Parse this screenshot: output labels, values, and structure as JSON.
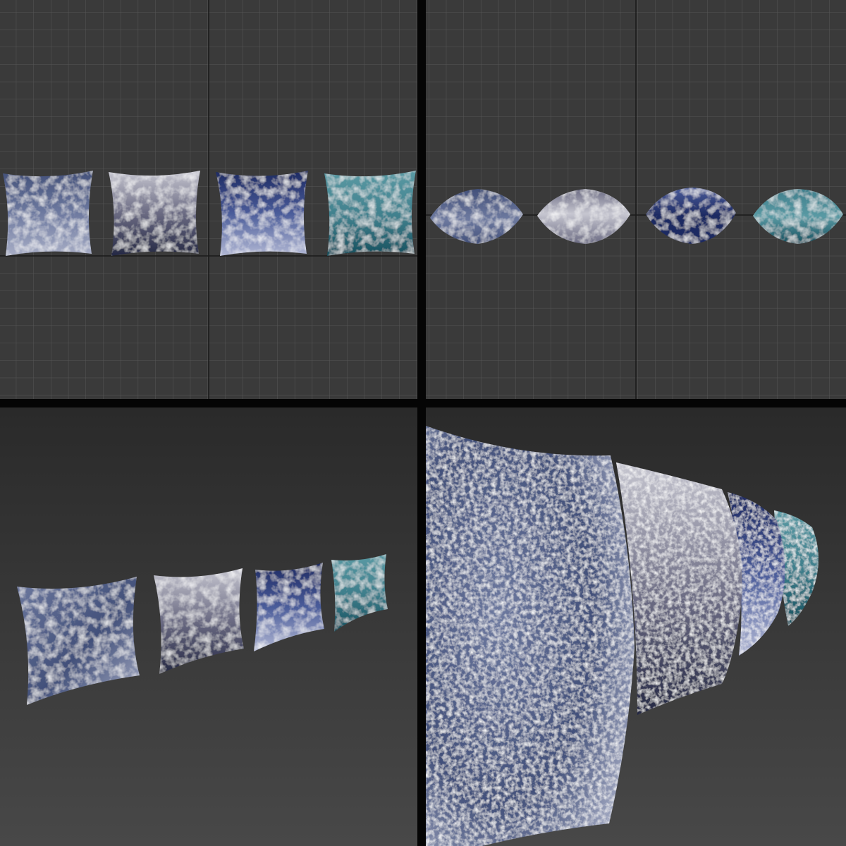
{
  "colors": {
    "ortho_background": "#3a3a3a",
    "grid_minor": "#565656",
    "grid_axis": "#1a1a1a",
    "persp_background_top": "#2a2a2a",
    "persp_background_bottom": "#484848",
    "divider": "#050505"
  },
  "pillows": [
    {
      "name": "pillow-slate-velvet",
      "colors": [
        "#42507a",
        "#6e7aa0",
        "#a8aec6"
      ],
      "speckle": "#c9cddc"
    },
    {
      "name": "pillow-silver-navy-ombre",
      "colors": [
        "#c6c6d0",
        "#6a6a82",
        "#242844"
      ],
      "speckle": "#d8d8e0"
    },
    {
      "name": "pillow-royal-blue-ombre",
      "colors": [
        "#1d2a62",
        "#4a5c9a",
        "#b2b8d4"
      ],
      "speckle": "#8a96c8"
    },
    {
      "name": "pillow-teal-velvet",
      "colors": [
        "#5a9aa4",
        "#3f7f8c",
        "#16505e"
      ],
      "speckle": "#9fd0d4"
    }
  ],
  "viewports": [
    {
      "id": "front",
      "kind": "orthographic-front"
    },
    {
      "id": "top",
      "kind": "orthographic-top"
    },
    {
      "id": "perspective",
      "kind": "perspective"
    },
    {
      "id": "camera",
      "kind": "camera-closeup"
    }
  ]
}
